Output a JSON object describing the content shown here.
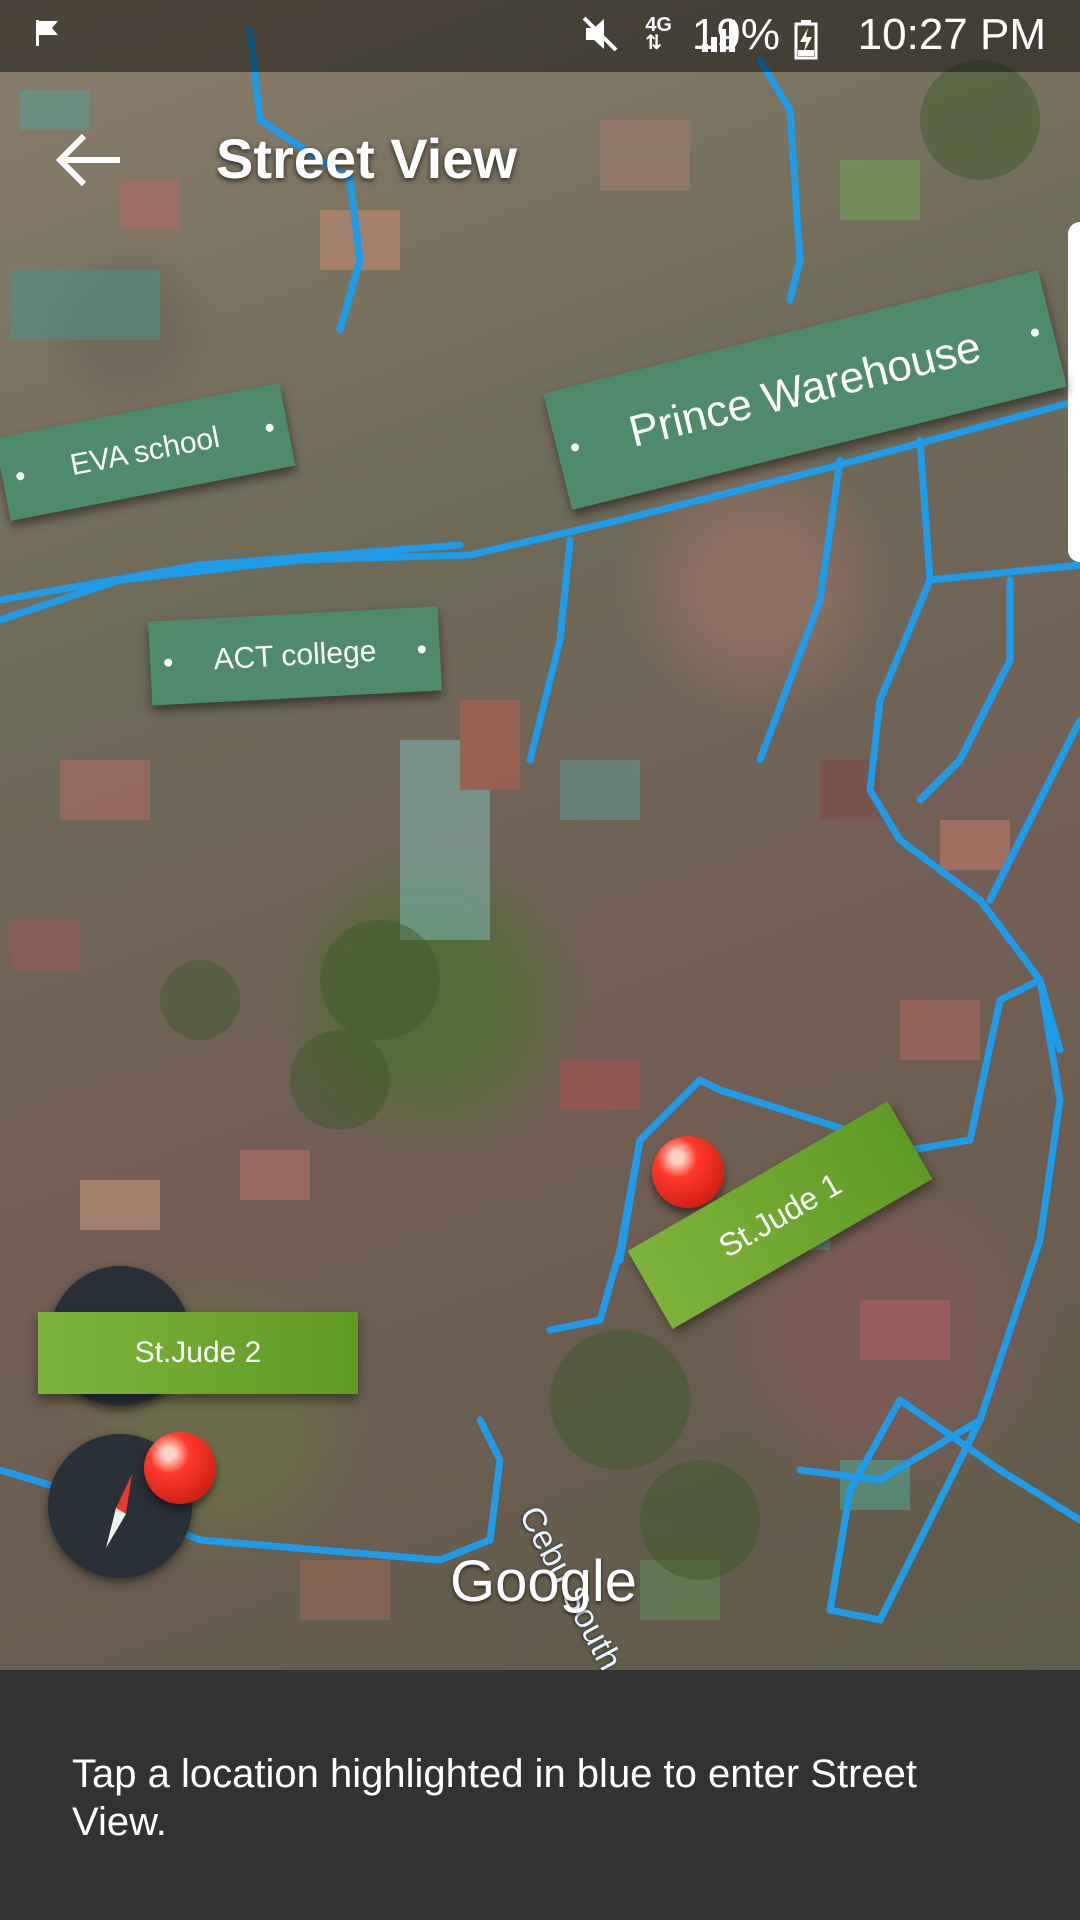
{
  "status_bar": {
    "network": "4G",
    "battery": "19%",
    "time": "10:27 PM",
    "icons": [
      "flag-icon",
      "mute-icon",
      "network-4g-icon",
      "signal-icon",
      "battery-charging-icon"
    ]
  },
  "header": {
    "title": "Street View",
    "back_icon": "arrow-left-icon"
  },
  "map": {
    "labels": {
      "eva_school": "EVA school",
      "prince_warehouse": "Prince Warehouse",
      "act_college": "ACT college",
      "st_jude_1": "St.Jude 1",
      "st_jude_2": "St.Jude 2"
    },
    "street_name": "Cebu South",
    "attribution": "Google",
    "road_highlight_color": "#1e9be9"
  },
  "info_panel": {
    "message": "Tap a location highlighted in blue to enter Street View."
  }
}
